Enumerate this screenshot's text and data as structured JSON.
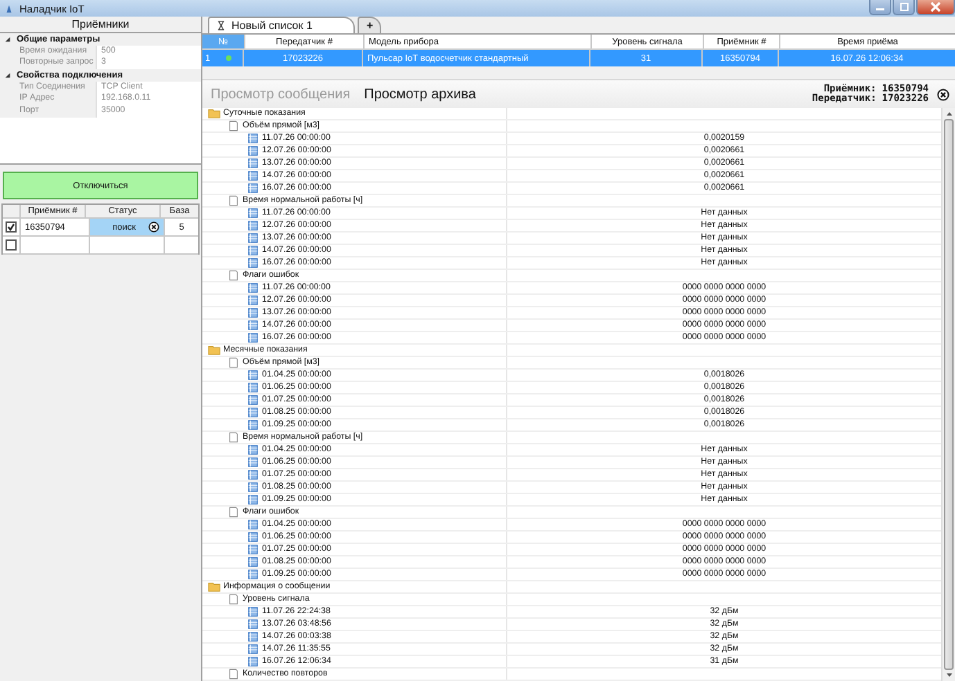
{
  "window": {
    "title": "Наладчик IoT"
  },
  "left_panel": {
    "title": "Приёмники",
    "property_groups": [
      {
        "title": "Общие параметры",
        "expanded": true,
        "properties": [
          {
            "name": "Время ожидания",
            "value": "500"
          },
          {
            "name": "Повторные запрос",
            "value": "3"
          }
        ]
      },
      {
        "title": "Свойства подключения",
        "expanded": true,
        "properties": [
          {
            "name": "Тип Соединения",
            "value": "TCP Client"
          },
          {
            "name": "IP Адрес",
            "value": "192.168.0.11"
          },
          {
            "name": "Порт",
            "value": "35000"
          }
        ]
      }
    ],
    "disconnect_button": "Отключиться",
    "receivers_table": {
      "columns": [
        "Приёмник #",
        "Статус",
        "База"
      ],
      "rows": [
        {
          "checked": true,
          "receiver": "16350794",
          "status": "поиск",
          "base": "5"
        },
        {
          "checked": false
        }
      ]
    }
  },
  "tabs": [
    {
      "label": "Новый список 1",
      "selected": true
    },
    {
      "label": "+",
      "selected": false
    }
  ],
  "devices_table": {
    "columns": [
      "№",
      "Передатчик #",
      "Модель прибора",
      "Уровень сигнала",
      "Приёмник #",
      "Время приёма"
    ],
    "rows": [
      {
        "index": "1",
        "online": true,
        "transmitter": "17023226",
        "model": "Пульсар IoT водосчетчик стандартный",
        "signal": "31",
        "receiver": "16350794",
        "time": "16.07.26 12:06:34",
        "selected": true
      }
    ]
  },
  "view_tabs": [
    {
      "label": "Просмотр сообщения",
      "selected": false
    },
    {
      "label": "Просмотр архива",
      "selected": true
    }
  ],
  "info": {
    "receiver_label": "Приёмник:",
    "receiver": "16350794",
    "transmitter_label": "Передатчик:",
    "transmitter": "17023226"
  },
  "tree": [
    {
      "label": "Суточные показания",
      "children": [
        {
          "label": "Объём прямой [м3]",
          "children": [
            {
              "label": "11.07.26 00:00:00",
              "value": "0,0020159"
            },
            {
              "label": "12.07.26 00:00:00",
              "value": "0,0020661"
            },
            {
              "label": "13.07.26 00:00:00",
              "value": "0,0020661"
            },
            {
              "label": "14.07.26 00:00:00",
              "value": "0,0020661"
            },
            {
              "label": "16.07.26 00:00:00",
              "value": "0,0020661"
            }
          ]
        },
        {
          "label": "Время нормальной работы [ч]",
          "children": [
            {
              "label": "11.07.26 00:00:00",
              "value": "Нет данных"
            },
            {
              "label": "12.07.26 00:00:00",
              "value": "Нет данных"
            },
            {
              "label": "13.07.26 00:00:00",
              "value": "Нет данных"
            },
            {
              "label": "14.07.26 00:00:00",
              "value": "Нет данных"
            },
            {
              "label": "16.07.26 00:00:00",
              "value": "Нет данных"
            }
          ]
        },
        {
          "label": "Флаги ошибок",
          "children": [
            {
              "label": "11.07.26 00:00:00",
              "value": "0000 0000 0000 0000"
            },
            {
              "label": "12.07.26 00:00:00",
              "value": "0000 0000 0000 0000"
            },
            {
              "label": "13.07.26 00:00:00",
              "value": "0000 0000 0000 0000"
            },
            {
              "label": "14.07.26 00:00:00",
              "value": "0000 0000 0000 0000"
            },
            {
              "label": "16.07.26 00:00:00",
              "value": "0000 0000 0000 0000"
            }
          ]
        }
      ]
    },
    {
      "label": "Месячные показания",
      "children": [
        {
          "label": "Объём прямой [м3]",
          "children": [
            {
              "label": "01.04.25 00:00:00",
              "value": "0,0018026"
            },
            {
              "label": "01.06.25 00:00:00",
              "value": "0,0018026"
            },
            {
              "label": "01.07.25 00:00:00",
              "value": "0,0018026"
            },
            {
              "label": "01.08.25 00:00:00",
              "value": "0,0018026"
            },
            {
              "label": "01.09.25 00:00:00",
              "value": "0,0018026"
            }
          ]
        },
        {
          "label": "Время нормальной работы [ч]",
          "children": [
            {
              "label": "01.04.25 00:00:00",
              "value": "Нет данных"
            },
            {
              "label": "01.06.25 00:00:00",
              "value": "Нет данных"
            },
            {
              "label": "01.07.25 00:00:00",
              "value": "Нет данных"
            },
            {
              "label": "01.08.25 00:00:00",
              "value": "Нет данных"
            },
            {
              "label": "01.09.25 00:00:00",
              "value": "Нет данных"
            }
          ]
        },
        {
          "label": "Флаги ошибок",
          "children": [
            {
              "label": "01.04.25 00:00:00",
              "value": "0000 0000 0000 0000"
            },
            {
              "label": "01.06.25 00:00:00",
              "value": "0000 0000 0000 0000"
            },
            {
              "label": "01.07.25 00:00:00",
              "value": "0000 0000 0000 0000"
            },
            {
              "label": "01.08.25 00:00:00",
              "value": "0000 0000 0000 0000"
            },
            {
              "label": "01.09.25 00:00:00",
              "value": "0000 0000 0000 0000"
            }
          ]
        }
      ]
    },
    {
      "label": "Информация о сообщении",
      "children": [
        {
          "label": "Уровень сигнала",
          "children": [
            {
              "label": "11.07.26 22:24:38",
              "value": "32 дБм"
            },
            {
              "label": "13.07.26 03:48:56",
              "value": "32 дБм"
            },
            {
              "label": "14.07.26 00:03:38",
              "value": "32 дБм"
            },
            {
              "label": "14.07.26 11:35:55",
              "value": "32 дБм"
            },
            {
              "label": "16.07.26 12:06:34",
              "value": "31 дБм"
            }
          ]
        },
        {
          "label": "Количество повторов"
        }
      ]
    }
  ]
}
